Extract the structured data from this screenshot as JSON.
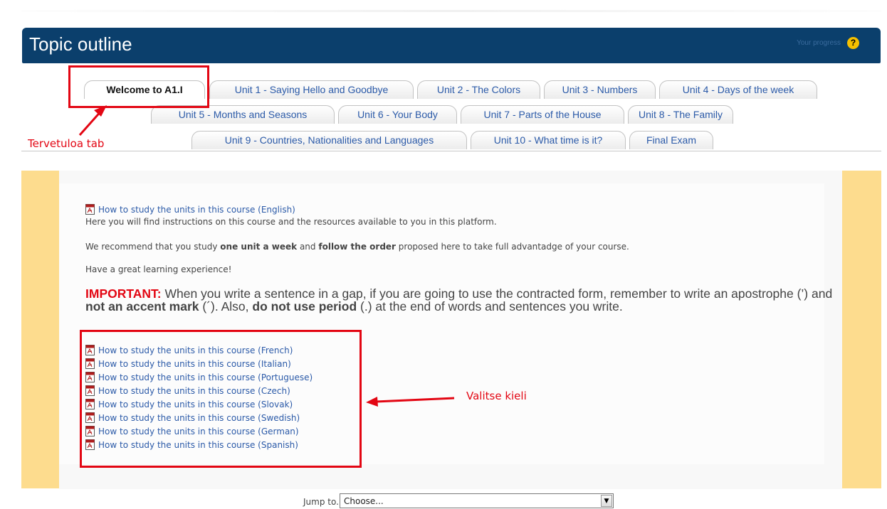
{
  "header": {
    "title": "Topic outline",
    "progress_label": "Your progress",
    "help_icon_glyph": "?"
  },
  "tabs": {
    "row1": [
      "Welcome to A1.I",
      "Unit 1 - Saying Hello and Goodbye",
      "Unit 2 - The Colors",
      "Unit 3 - Numbers",
      "Unit 4 - Days of the week"
    ],
    "row2": [
      "Unit 5 - Months and Seasons",
      "Unit 6 - Your Body",
      "Unit 7 - Parts of the House",
      "Unit 8 - The Family"
    ],
    "row3": [
      "Unit 9 - Countries, Nationalities and Languages",
      "Unit 10 - What time is it?",
      "Final Exam"
    ],
    "active": "Welcome to A1.I"
  },
  "annotations": {
    "tab_label": "Tervetuloa tab",
    "language_label": "Valitse kieli",
    "color": "#e30613"
  },
  "content": {
    "english_link": "How to study the units in this course (English)",
    "intro": "Here you will find instructions on this course and the resources available to you in this platform.",
    "recommend": {
      "pre": "We recommend that you study ",
      "bold1": "one unit a week",
      "mid": " and ",
      "bold2": "follow the order",
      "post": " proposed here to take full advantadge of your course."
    },
    "experience": "Have a great learning experience!",
    "important": {
      "label": "IMPORTANT:",
      "t1": " When you write a sentence in a gap, if you are going to use the contracted form, remember to write an apostrophe (’) and ",
      "b1": "not an accent mark",
      "t2": " (´). Also, ",
      "b2": "do not use period",
      "t3": " (.) at the end of words and sentences you write."
    },
    "language_links": [
      "How to study the units in this course (French)",
      "How to study the units in this course (Italian)",
      "How to study the units in this course (Portuguese)",
      "How to study the units in this course (Czech)",
      "How to study the units in this course (Slovak)",
      "How to study the units in this course (Swedish)",
      "How to study the units in this course (German)",
      "How to study the units in this course (Spanish)"
    ]
  },
  "jump": {
    "label": "Jump to...",
    "selected": "Choose...",
    "arrow_glyph": "▼"
  },
  "colors": {
    "header_bg": "#0b3f6c",
    "link": "#2b5aa8",
    "side_band": "#fddc8e"
  }
}
